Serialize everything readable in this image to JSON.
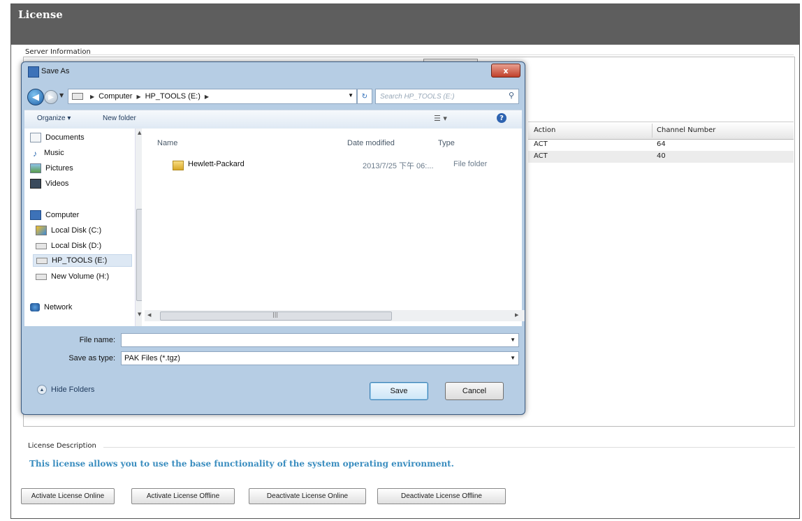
{
  "header": {
    "title": "License"
  },
  "server_info": {
    "label": "Server Information",
    "table": {
      "columns": [
        "Action",
        "Channel Number"
      ],
      "rows": [
        {
          "action": "ACT",
          "channel": "64"
        },
        {
          "action": "ACT",
          "channel": "40"
        }
      ]
    }
  },
  "description": {
    "label": "License Description",
    "text": "This license allows you to use the base functionality of the system operating environment."
  },
  "footer_buttons": [
    "Activate License Online",
    "Activate License Offline",
    "Deactivate License Online",
    "Deactivate License Offline"
  ],
  "dialog": {
    "title": "Save As",
    "close_label": "x",
    "address": {
      "parts": [
        "Computer",
        "HP_TOOLS (E:)"
      ]
    },
    "search_placeholder": "Search HP_TOOLS (E:)",
    "toolbar": {
      "organize": "Organize ▾",
      "new_folder": "New folder"
    },
    "nav_items": [
      {
        "label": "Documents",
        "icon": "documents-icon"
      },
      {
        "label": "Music",
        "icon": "music-icon"
      },
      {
        "label": "Pictures",
        "icon": "pictures-icon"
      },
      {
        "label": "Videos",
        "icon": "videos-icon"
      },
      {
        "label": "Computer",
        "icon": "computer-icon"
      },
      {
        "label": "Local Disk (C:)",
        "icon": "local-disk-icon"
      },
      {
        "label": "Local Disk (D:)",
        "icon": "drive-icon"
      },
      {
        "label": "HP_TOOLS (E:)",
        "icon": "drive-icon",
        "selected": true
      },
      {
        "label": "New Volume (H:)",
        "icon": "drive-icon"
      },
      {
        "label": "Network",
        "icon": "network-icon"
      }
    ],
    "columns": {
      "name": "Name",
      "date": "Date modified",
      "type": "Type"
    },
    "files": [
      {
        "name": "Hewlett-Packard",
        "date": "2013/7/25 下午 06:...",
        "type": "File folder"
      }
    ],
    "file_name_label": "File name:",
    "file_name_value": "",
    "save_type_label": "Save as type:",
    "save_type_value": "PAK Files (*.tgz)",
    "hide_folders": "Hide Folders",
    "save_button": "Save",
    "cancel_button": "Cancel"
  }
}
